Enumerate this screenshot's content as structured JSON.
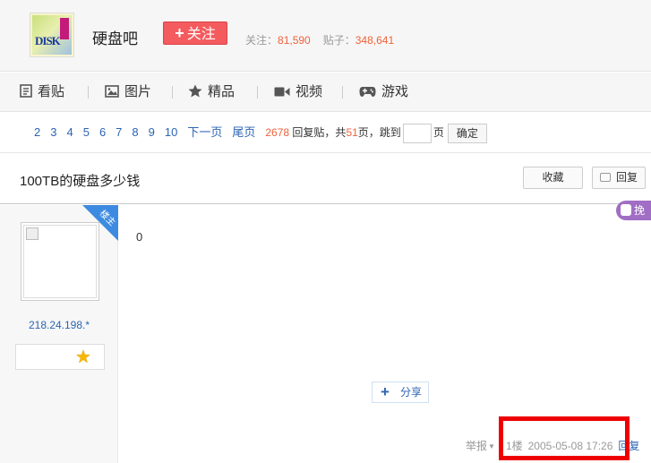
{
  "header": {
    "forum_name": "硬盘吧",
    "follow_label": "关注",
    "follow_plus": "+",
    "logo_text": "DISK",
    "stats": {
      "follow_label": "关注：",
      "follow_count": "81,590",
      "post_label": "贴子：",
      "post_count": "348,641"
    }
  },
  "nav": {
    "items": [
      {
        "label": "看贴",
        "icon": "document-icon"
      },
      {
        "label": "图片",
        "icon": "image-icon"
      },
      {
        "label": "精品",
        "icon": "star-icon"
      },
      {
        "label": "视频",
        "icon": "video-camera-icon"
      },
      {
        "label": "游戏",
        "icon": "gamepad-icon"
      }
    ]
  },
  "pager": {
    "pages": [
      "2",
      "3",
      "4",
      "5",
      "6",
      "7",
      "8",
      "9",
      "10"
    ],
    "next_label": "下一页",
    "last_label": "尾页",
    "reply_count": "2678",
    "reply_label": "回复贴，共",
    "page_total": "51",
    "page_suffix": "页，跳到",
    "page_unit": "页",
    "confirm_label": "确定",
    "input_value": ""
  },
  "thread": {
    "title": "100TB的硬盘多少钱",
    "favorite_label": "收藏",
    "reply_label": "回复",
    "swap_label": "挽"
  },
  "post": {
    "badge": "楼主",
    "ip": "218.24.198.*",
    "content": "0",
    "share_label": "分享",
    "report_label": "举报",
    "floor": "1楼",
    "time": "2005-05-08 17:26",
    "reply_label": "回复"
  },
  "colors": {
    "accent_red": "#f45b5e",
    "link_blue": "#2d64b3",
    "count_orange": "#f0623a",
    "highlight": "#ee0000"
  }
}
